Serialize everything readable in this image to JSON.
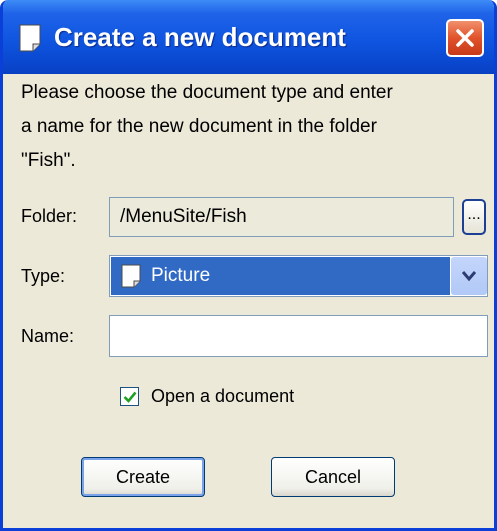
{
  "window": {
    "title": "Create a new document",
    "close_label": "×"
  },
  "intro_lines": [
    "Please choose the document type and enter",
    "a name for the new document in the folder",
    "\"Fish\"."
  ],
  "folder": {
    "label": "Folder:",
    "value": "/MenuSite/Fish",
    "browse_label": "..."
  },
  "type": {
    "label": "Type:",
    "selected": "Picture"
  },
  "name": {
    "label": "Name:",
    "value": ""
  },
  "open_document": {
    "label": "Open a document",
    "checked": true
  },
  "buttons": {
    "create": "Create",
    "cancel": "Cancel"
  },
  "colors": {
    "titlebar": "#0a47cf",
    "dialog_bg": "#ece9d8",
    "selection": "#316ac5",
    "close": "#e0532b"
  }
}
